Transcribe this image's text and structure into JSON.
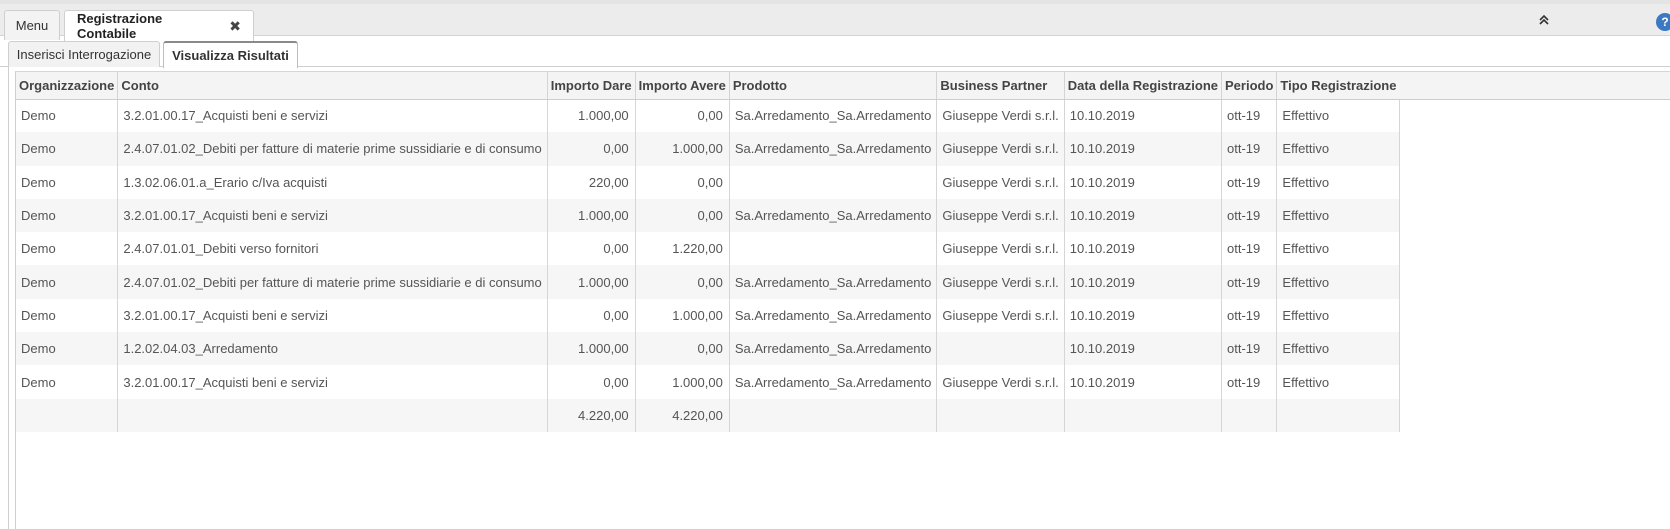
{
  "top_tabs": {
    "menu": "Menu",
    "active": "Registrazione Contabile",
    "close_glyph": "✖"
  },
  "toolbar": {
    "collapse_glyph": "⌃⌃",
    "help_glyph": "?"
  },
  "sub_tabs": {
    "query": "Inserisci Interrogazione",
    "results": "Visualizza Risultati"
  },
  "table": {
    "columns": [
      "Organizzazione",
      "Conto",
      "Importo Dare",
      "Importo Avere",
      "Prodotto",
      "Business Partner",
      "Data della Registrazione",
      "Periodo",
      "Tipo Registrazione"
    ],
    "rows": [
      [
        "Demo",
        "3.2.01.00.17_Acquisti beni e servizi",
        "1.000,00",
        "0,00",
        "Sa.Arredamento_Sa.Arredamento",
        "Giuseppe Verdi s.r.l.",
        "10.10.2019",
        "ott-19",
        "Effettivo"
      ],
      [
        "Demo",
        "2.4.07.01.02_Debiti per fatture di materie prime sussidiarie e di consumo",
        "0,00",
        "1.000,00",
        "Sa.Arredamento_Sa.Arredamento",
        "Giuseppe Verdi s.r.l.",
        "10.10.2019",
        "ott-19",
        "Effettivo"
      ],
      [
        "Demo",
        "1.3.02.06.01.a_Erario c/Iva acquisti",
        "220,00",
        "0,00",
        "",
        "Giuseppe Verdi s.r.l.",
        "10.10.2019",
        "ott-19",
        "Effettivo"
      ],
      [
        "Demo",
        "3.2.01.00.17_Acquisti beni e servizi",
        "1.000,00",
        "0,00",
        "Sa.Arredamento_Sa.Arredamento",
        "Giuseppe Verdi s.r.l.",
        "10.10.2019",
        "ott-19",
        "Effettivo"
      ],
      [
        "Demo",
        "2.4.07.01.01_Debiti verso fornitori",
        "0,00",
        "1.220,00",
        "",
        "Giuseppe Verdi s.r.l.",
        "10.10.2019",
        "ott-19",
        "Effettivo"
      ],
      [
        "Demo",
        "2.4.07.01.02_Debiti per fatture di materie prime sussidiarie e di consumo",
        "1.000,00",
        "0,00",
        "Sa.Arredamento_Sa.Arredamento",
        "Giuseppe Verdi s.r.l.",
        "10.10.2019",
        "ott-19",
        "Effettivo"
      ],
      [
        "Demo",
        "3.2.01.00.17_Acquisti beni e servizi",
        "0,00",
        "1.000,00",
        "Sa.Arredamento_Sa.Arredamento",
        "Giuseppe Verdi s.r.l.",
        "10.10.2019",
        "ott-19",
        "Effettivo"
      ],
      [
        "Demo",
        "1.2.02.04.03_Arredamento",
        "1.000,00",
        "0,00",
        "Sa.Arredamento_Sa.Arredamento",
        "",
        "10.10.2019",
        "ott-19",
        "Effettivo"
      ],
      [
        "Demo",
        "3.2.01.00.17_Acquisti beni e servizi",
        "0,00",
        "1.000,00",
        "Sa.Arredamento_Sa.Arredamento",
        "Giuseppe Verdi s.r.l.",
        "10.10.2019",
        "ott-19",
        "Effettivo"
      ],
      [
        "",
        "",
        "4.220,00",
        "4.220,00",
        "",
        "",
        "",
        "",
        ""
      ]
    ]
  }
}
